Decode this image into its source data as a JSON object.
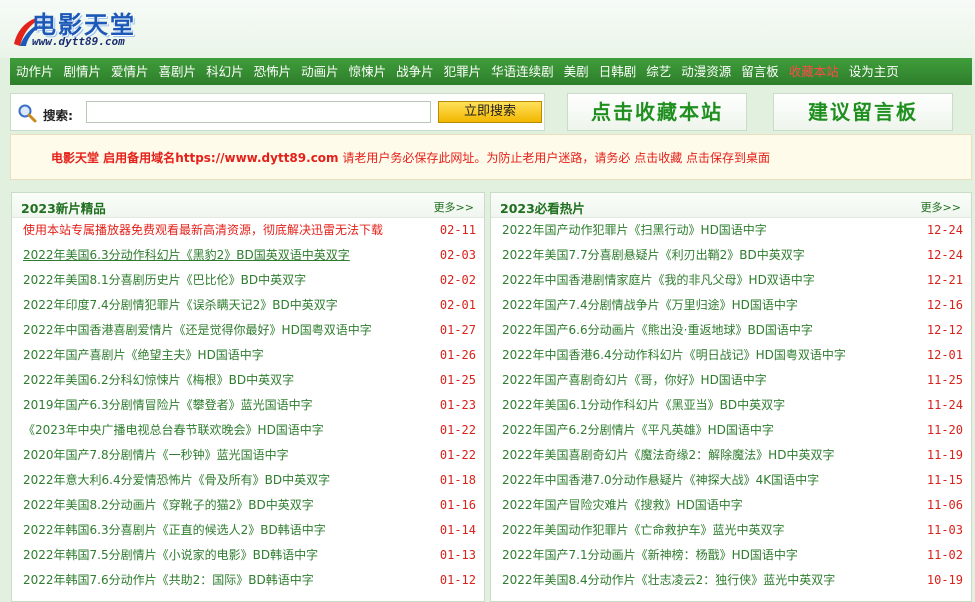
{
  "logo": {
    "title": "电影天堂",
    "url": "www.dytt89.com"
  },
  "nav": [
    {
      "label": "动作片"
    },
    {
      "label": "剧情片"
    },
    {
      "label": "爱情片"
    },
    {
      "label": "喜剧片"
    },
    {
      "label": "科幻片"
    },
    {
      "label": "恐怖片"
    },
    {
      "label": "动画片"
    },
    {
      "label": "惊悚片"
    },
    {
      "label": "战争片"
    },
    {
      "label": "犯罪片"
    },
    {
      "label": "华语连续剧"
    },
    {
      "label": "美剧"
    },
    {
      "label": "日韩剧"
    },
    {
      "label": "综艺"
    },
    {
      "label": "动漫资源"
    },
    {
      "label": "留言板"
    },
    {
      "label": "收藏本站"
    },
    {
      "label": "设为主页"
    }
  ],
  "search": {
    "label": "搜索:",
    "value": "",
    "button": "立即搜索"
  },
  "buttons": {
    "favorite": "点击收藏本站",
    "message": "建议留言板"
  },
  "notice": {
    "part1": "电影天堂 启用备用域名",
    "url": "https://www.dytt89.com",
    "part2": " 请老用户务必保存此网址。为防止老用户迷路，请务必 点击收藏 点击保存到桌面"
  },
  "left_panel": {
    "title": "2023新片精品",
    "more": "更多>>",
    "items": [
      {
        "title": "使用本站专属播放器免费观看最新高清资源，彻底解决迅雷无法下载",
        "date": "02-11"
      },
      {
        "title": "2022年美国6.3分动作科幻片《黑豹2》BD国英双语中英双字",
        "date": "02-03"
      },
      {
        "title": "2022年美国8.1分喜剧历史片《巴比伦》BD中英双字",
        "date": "02-02"
      },
      {
        "title": "2022年印度7.4分剧情犯罪片《误杀瞒天记2》BD中英双字",
        "date": "02-01"
      },
      {
        "title": "2022年中国香港喜剧爱情片《还是觉得你最好》HD国粤双语中字",
        "date": "01-27"
      },
      {
        "title": "2022年国产喜剧片《绝望主夫》HD国语中字",
        "date": "01-26"
      },
      {
        "title": "2022年美国6.2分科幻惊悚片《梅根》BD中英双字",
        "date": "01-25"
      },
      {
        "title": "2019年国产6.3分剧情冒险片《攀登者》蓝光国语中字",
        "date": "01-23"
      },
      {
        "title": "《2023年中央广播电视总台春节联欢晚会》HD国语中字",
        "date": "01-22"
      },
      {
        "title": "2020年国产7.8分剧情片《一秒钟》蓝光国语中字",
        "date": "01-22"
      },
      {
        "title": "2022年意大利6.4分爱情恐怖片《骨及所有》BD中英双字",
        "date": "01-18"
      },
      {
        "title": "2022年美国8.2分动画片《穿靴子的猫2》BD中英双字",
        "date": "01-16"
      },
      {
        "title": "2022年韩国6.3分喜剧片《正直的候选人2》BD韩语中字",
        "date": "01-14"
      },
      {
        "title": "2022年韩国7.5分剧情片《小说家的电影》BD韩语中字",
        "date": "01-13"
      },
      {
        "title": "2022年韩国7.6分动作片《共助2：国际》BD韩语中字",
        "date": "01-12"
      }
    ]
  },
  "right_panel": {
    "title": "2023必看热片",
    "more": "更多>>",
    "items": [
      {
        "title": "2022年国产动作犯罪片《扫黑行动》HD国语中字",
        "date": "12-24"
      },
      {
        "title": "2022年美国7.7分喜剧悬疑片《利刃出鞘2》BD中英双字",
        "date": "12-24"
      },
      {
        "title": "2022年中国香港剧情家庭片《我的非凡父母》HD双语中字",
        "date": "12-21"
      },
      {
        "title": "2022年国产7.4分剧情战争片《万里归途》HD国语中字",
        "date": "12-16"
      },
      {
        "title": "2022年国产6.6分动画片《熊出没·重返地球》BD国语中字",
        "date": "12-12"
      },
      {
        "title": "2022年中国香港6.4分动作科幻片《明日战记》HD国粤双语中字",
        "date": "12-01"
      },
      {
        "title": "2022年国产喜剧奇幻片《哥，你好》HD国语中字",
        "date": "11-25"
      },
      {
        "title": "2022年美国6.1分动作科幻片《黑亚当》BD中英双字",
        "date": "11-24"
      },
      {
        "title": "2022年国产6.2分剧情片《平凡英雄》HD国语中字",
        "date": "11-20"
      },
      {
        "title": "2022年美国喜剧奇幻片《魔法奇缘2：解除魔法》HD中英双字",
        "date": "11-19"
      },
      {
        "title": "2022年中国香港7.0分动作悬疑片《神探大战》4K国语中字",
        "date": "11-15"
      },
      {
        "title": "2022年国产冒险灾难片《搜救》HD国语中字",
        "date": "11-06"
      },
      {
        "title": "2022年美国动作犯罪片《亡命救护车》蓝光中英双字",
        "date": "11-03"
      },
      {
        "title": "2022年国产7.1分动画片《新神榜：杨戬》HD国语中字",
        "date": "11-02"
      },
      {
        "title": "2022年美国8.4分动作片《壮志凌云2：独行侠》蓝光中英双字",
        "date": "10-19"
      }
    ]
  },
  "colors": {
    "nav_green": "#2e7e2b",
    "link_green": "#2e7d2e",
    "date_red": "#d8221b",
    "notice_red": "#e5201a"
  }
}
